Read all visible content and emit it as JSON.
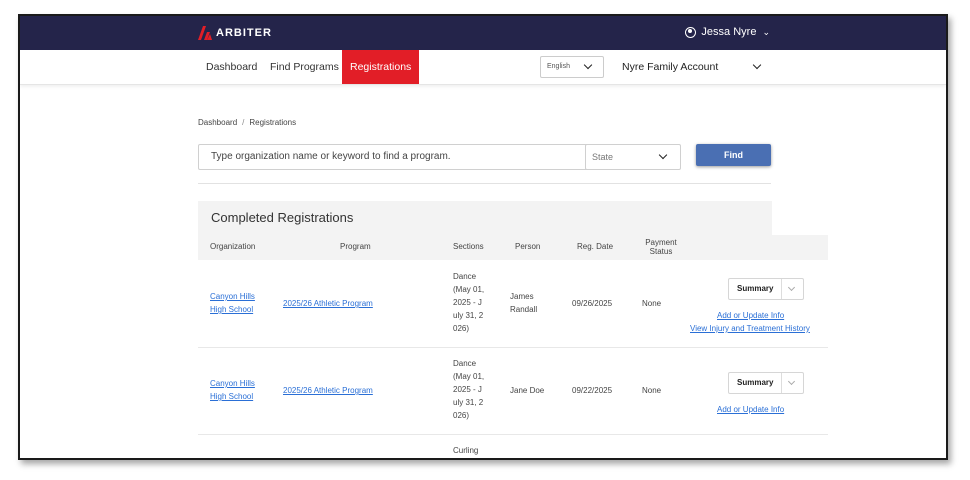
{
  "header": {
    "logo_text": "ARBITER",
    "user_name": "Jessa Nyre"
  },
  "nav": {
    "items": [
      {
        "label": "Dashboard"
      },
      {
        "label": "Find Programs"
      },
      {
        "label": "Registrations"
      }
    ],
    "active": "Registrations",
    "language": "English",
    "account": "Nyre Family Account"
  },
  "breadcrumb": {
    "items": [
      "Dashboard",
      "Registrations"
    ],
    "separator": "/"
  },
  "search": {
    "placeholder": "Type organization name or keyword to find a program.",
    "state_placeholder": "State",
    "find_label": "Find"
  },
  "card": {
    "title": "Completed Registrations",
    "columns": {
      "organization": "Organization",
      "program": "Program",
      "sections": "Sections",
      "person": "Person",
      "reg_date": "Reg. Date",
      "payment_status_line1": "Payment",
      "payment_status_line2": "Status"
    },
    "rows": [
      {
        "org_line1": "Canyon Hills",
        "org_line2": "High School",
        "program": "2025/26 Athletic Program",
        "sections": [
          "Dance",
          "(May 01,",
          "2025 - J",
          "uly 31, 2",
          "026)"
        ],
        "person_line1": "James",
        "person_line2": "Randall",
        "reg_date": "09/26/2025",
        "payment_status": "None",
        "summary_label": "Summary",
        "links": [
          "Add or Update Info",
          "View Injury and Treatment History"
        ]
      },
      {
        "org_line1": "Canyon Hills",
        "org_line2": "High School",
        "program": "2025/26 Athletic Program",
        "sections": [
          "Dance",
          "(May 01,",
          "2025 - J",
          "uly 31, 2",
          "026)"
        ],
        "person_line1": "Jane Doe",
        "person_line2": "",
        "reg_date": "09/22/2025",
        "payment_status": "None",
        "summary_label": "Summary",
        "links": [
          "Add or Update Info"
        ]
      },
      {
        "sections": [
          "Curling"
        ]
      }
    ]
  },
  "colors": {
    "topbar": "#24244a",
    "active_tab": "#e21e27",
    "find_button": "#4a6fb3",
    "link": "#2a6fd6"
  }
}
